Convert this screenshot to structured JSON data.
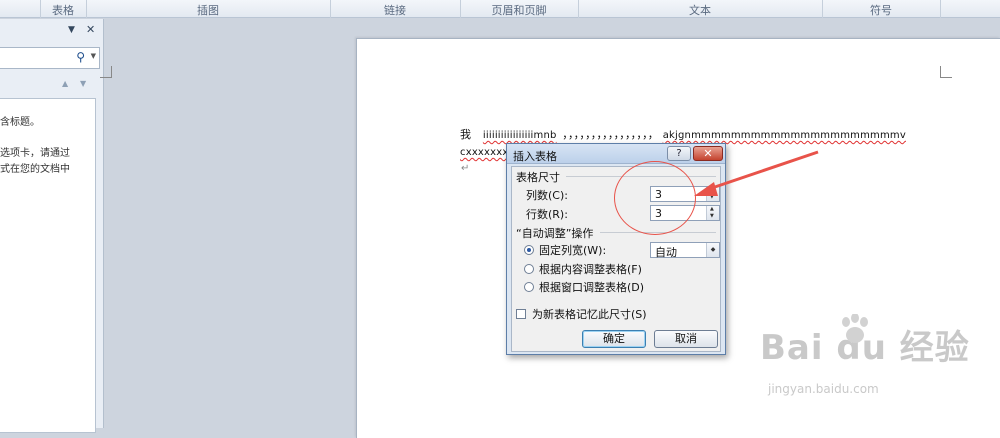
{
  "ribbon": {
    "groups": [
      "表格",
      "插图",
      "链接",
      "页眉和页脚",
      "文本",
      "符号"
    ]
  },
  "nav_pane": {
    "text_lines": [
      "含标题。",
      "选项卡，请通过",
      "式在您的文档中"
    ]
  },
  "document": {
    "line1_start": "我",
    "line1_misspelled": "iiiiiiiiiiiiiiiiimnb",
    "line1_punct": "，，，，，，，，，，，，，，，，",
    "line1_end": "akjgnmmmmmmmmmmmmmmmmmmmmmv",
    "line2": "cxxxxxxxx"
  },
  "dialog": {
    "title": "插入表格",
    "help_glyph": "?",
    "close_glyph": "✕",
    "size_section": "表格尺寸",
    "columns_label": "列数(C):",
    "columns_value": "3",
    "rows_label": "行数(R):",
    "rows_value": "3",
    "autofit_section": "“自动调整”操作",
    "fixed_width_label": "固定列宽(W):",
    "fixed_width_value": "自动",
    "autofit_content_label": "根据内容调整表格(F)",
    "autofit_window_label": "根据窗口调整表格(D)",
    "remember_label": "为新表格记忆此尺寸(S)",
    "ok_label": "确定",
    "cancel_label": "取消"
  },
  "watermark": {
    "brand": "Bai du 经验",
    "url": "jingyan.baidu.com"
  },
  "colors": {
    "annotation": "#e8534a",
    "dialog_bg": "#dce6f2",
    "close_button": "#c4432f"
  }
}
